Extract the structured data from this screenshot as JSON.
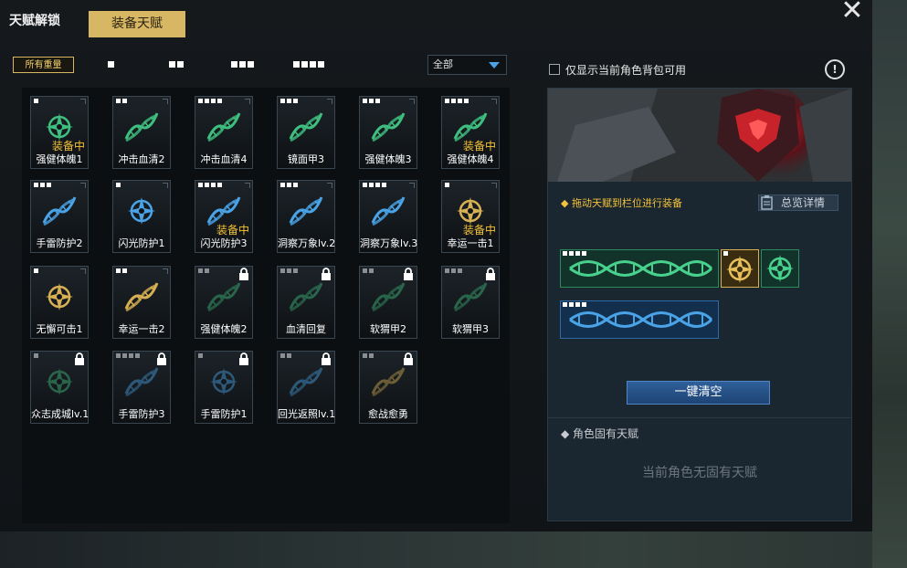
{
  "tabs": {
    "unlock": "天赋解锁",
    "equip": "装备天赋"
  },
  "filters": {
    "all_weight": "所有重量"
  },
  "dropdown": {
    "selected": "全部"
  },
  "checkbox_label": "仅显示当前角色背包可用",
  "equipped_text": "装备中",
  "cards": [
    {
      "label": "强健体魄1",
      "dots": 1,
      "equipped": true,
      "locked": false,
      "shape": "rune",
      "color": "#3fbf7f"
    },
    {
      "label": "冲击血清2",
      "dots": 2,
      "equipped": false,
      "locked": false,
      "shape": "dna",
      "color": "#3fbf7f"
    },
    {
      "label": "冲击血清4",
      "dots": 4,
      "equipped": false,
      "locked": false,
      "shape": "dna",
      "color": "#3fbf7f"
    },
    {
      "label": "镜面甲3",
      "dots": 3,
      "equipped": false,
      "locked": false,
      "shape": "dna",
      "color": "#3fbf7f"
    },
    {
      "label": "强健体魄3",
      "dots": 3,
      "equipped": false,
      "locked": false,
      "shape": "dna",
      "color": "#3fbf7f"
    },
    {
      "label": "强健体魄4",
      "dots": 4,
      "equipped": true,
      "locked": false,
      "shape": "dna",
      "color": "#3fbf7f"
    },
    {
      "label": "手雷防护2",
      "dots": 3,
      "equipped": false,
      "locked": false,
      "shape": "dna",
      "color": "#4aa3e6"
    },
    {
      "label": "闪光防护1",
      "dots": 1,
      "equipped": false,
      "locked": false,
      "shape": "rune",
      "color": "#4aa3e6"
    },
    {
      "label": "闪光防护3",
      "dots": 4,
      "equipped": true,
      "locked": false,
      "shape": "dna",
      "color": "#4aa3e6"
    },
    {
      "label": "洞察万象lv.2",
      "dots": 3,
      "equipped": false,
      "locked": false,
      "shape": "dna",
      "color": "#4aa3e6"
    },
    {
      "label": "洞察万象lv.3",
      "dots": 4,
      "equipped": false,
      "locked": false,
      "shape": "dna",
      "color": "#4aa3e6"
    },
    {
      "label": "幸运一击1",
      "dots": 1,
      "equipped": true,
      "locked": false,
      "shape": "rune",
      "color": "#d7b053"
    },
    {
      "label": "无懈可击1",
      "dots": 1,
      "equipped": false,
      "locked": false,
      "shape": "rune",
      "color": "#d7b053"
    },
    {
      "label": "幸运一击2",
      "dots": 2,
      "equipped": false,
      "locked": false,
      "shape": "dna",
      "color": "#d7b053"
    },
    {
      "label": "强健体魄2",
      "dots": 2,
      "equipped": false,
      "locked": true,
      "shape": "dna",
      "color": "#3fbf7f"
    },
    {
      "label": "血清回复",
      "dots": 3,
      "equipped": false,
      "locked": true,
      "shape": "dna",
      "color": "#3fbf7f"
    },
    {
      "label": "软猬甲2",
      "dots": 2,
      "equipped": false,
      "locked": true,
      "shape": "dna",
      "color": "#3fbf7f"
    },
    {
      "label": "软猬甲3",
      "dots": 3,
      "equipped": false,
      "locked": true,
      "shape": "dna",
      "color": "#3fbf7f"
    },
    {
      "label": "众志成城lv.1",
      "dots": 1,
      "equipped": false,
      "locked": true,
      "shape": "rune",
      "color": "#3fbf7f"
    },
    {
      "label": "手雷防护3",
      "dots": 4,
      "equipped": false,
      "locked": true,
      "shape": "dna",
      "color": "#4aa3e6"
    },
    {
      "label": "手雷防护1",
      "dots": 1,
      "equipped": false,
      "locked": true,
      "shape": "rune",
      "color": "#4aa3e6"
    },
    {
      "label": "回光返照lv.1",
      "dots": 2,
      "equipped": false,
      "locked": true,
      "shape": "dna",
      "color": "#4aa3e6"
    },
    {
      "label": "愈战愈勇",
      "dots": 2,
      "equipped": false,
      "locked": true,
      "shape": "dna",
      "color": "#d7b053"
    }
  ],
  "right_panel": {
    "drag_hint": "拖动天赋到栏位进行装备",
    "detail_button": "总览详情",
    "clear_button": "一键清空",
    "inherent_title": "角色固有天赋",
    "inherent_empty": "当前角色无固有天赋"
  },
  "colors": {
    "gold": "#d7b764",
    "green": "#3fbf7f",
    "blue": "#4aa3e6",
    "yellow": "#f3c23a"
  }
}
